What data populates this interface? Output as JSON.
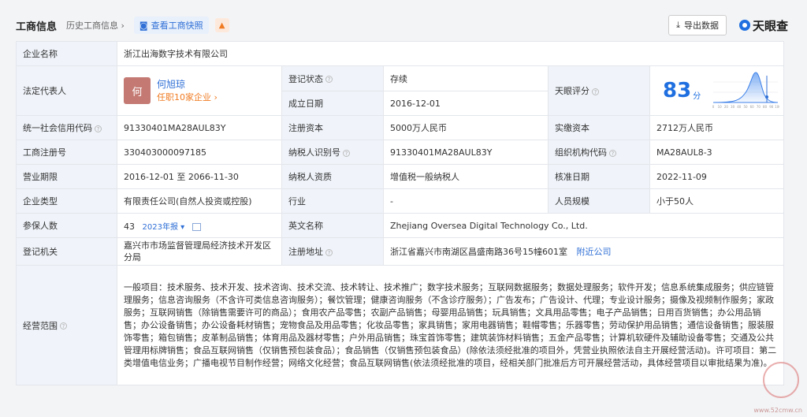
{
  "header": {
    "title": "工商信息",
    "history": "历史工商信息",
    "snapshot": "查看工商快照",
    "export": "导出数据",
    "logo": "天眼查"
  },
  "rows": {
    "company_name": {
      "label": "企业名称",
      "value": "浙江出海数字技术有限公司"
    },
    "legal_rep": {
      "label": "法定代表人",
      "avatar": "何",
      "name": "何旭琼",
      "sub": "任职10家企业"
    },
    "reg_status": {
      "label": "登记状态",
      "value": "存续"
    },
    "est_date": {
      "label": "成立日期",
      "value": "2016-12-01"
    },
    "rating": {
      "label": "天眼评分",
      "score": "83",
      "unit": "分",
      "axis": [
        "0",
        "10",
        "20",
        "30",
        "40",
        "50",
        "60",
        "70",
        "80",
        "90",
        "100"
      ]
    },
    "credit_code": {
      "label": "统一社会信用代码",
      "value": "91330401MA28AUL83Y"
    },
    "reg_capital": {
      "label": "注册资本",
      "value": "5000万人民币"
    },
    "paid_capital": {
      "label": "实缴资本",
      "value": "2712万人民币"
    },
    "biz_reg_no": {
      "label": "工商注册号",
      "value": "330403000097185"
    },
    "taxpayer_id": {
      "label": "纳税人识别号",
      "value": "91330401MA28AUL83Y"
    },
    "org_code": {
      "label": "组织机构代码",
      "value": "MA28AUL8-3"
    },
    "biz_term": {
      "label": "营业期限",
      "value": "2016-12-01 至 2066-11-30"
    },
    "taxpayer_qual": {
      "label": "纳税人资质",
      "value": "增值税一般纳税人"
    },
    "approval_date": {
      "label": "核准日期",
      "value": "2022-11-09"
    },
    "company_type": {
      "label": "企业类型",
      "value": "有限责任公司(自然人投资或控股)"
    },
    "industry": {
      "label": "行业",
      "value": "-"
    },
    "staff_size": {
      "label": "人员规模",
      "value": "小于50人"
    },
    "insured": {
      "label": "参保人数",
      "value": "43",
      "year": "2023年报"
    },
    "english_name": {
      "label": "英文名称",
      "value": "Zhejiang Oversea Digital Technology Co., Ltd."
    },
    "reg_authority": {
      "label": "登记机关",
      "value": "嘉兴市市场监督管理局经济技术开发区分局"
    },
    "reg_address": {
      "label": "注册地址",
      "value": "浙江省嘉兴市南湖区昌盛南路36号15幢601室",
      "link": "附近公司"
    },
    "scope": {
      "label": "经营范围",
      "value": "一般项目：技术服务、技术开发、技术咨询、技术交流、技术转让、技术推广；数字技术服务；互联网数据服务；数据处理服务；软件开发；信息系统集成服务；供应链管理服务；信息咨询服务（不含许可类信息咨询服务）；餐饮管理；健康咨询服务（不含诊疗服务）；广告发布；广告设计、代理；专业设计服务；摄像及视频制作服务；家政服务；互联网销售（除销售需要许可的商品）；食用农产品零售；农副产品销售；母婴用品销售；玩具销售；文具用品零售；电子产品销售；日用百货销售；办公用品销售；办公设备销售；办公设备耗材销售；宠物食品及用品零售；化妆品零售；家具销售；家用电器销售；鞋帽零售；乐器零售；劳动保护用品销售；通信设备销售；服装服饰零售；箱包销售；皮革制品销售；体育用品及器材零售；户外用品销售；珠宝首饰零售；建筑装饰材料销售；五金产品零售；计算机软硬件及辅助设备零售；交通及公共管理用标牌销售；食品互联网销售（仅销售预包装食品）；食品销售（仅销售预包装食品）(除依法须经批准的项目外，凭营业执照依法自主开展经营活动)。许可项目：第二类增值电信业务；广播电视节目制作经营；网络文化经营；食品互联网销售(依法须经批准的项目，经相关部门批准后方可开展经营活动，具体经营项目以审批结果为准)。"
    }
  },
  "watermark": "www.52cmw.cn",
  "colors": {
    "label_bg": "#f0f4fa",
    "accent": "#2f6fd6",
    "orange": "#f07b22",
    "green": "#2aa05a"
  }
}
